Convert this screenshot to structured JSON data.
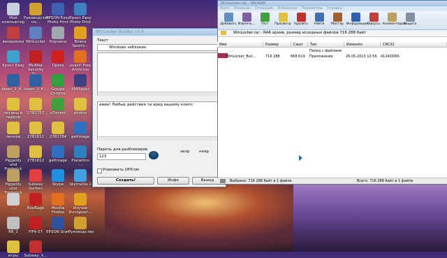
{
  "desktop": {
    "icons": [
      {
        "label": "Мой компьютер",
        "color": "#c8d0e0"
      },
      {
        "label": "Руководство по...",
        "color": "#d0a030"
      },
      {
        "label": "EPSON Easy Photo Print",
        "color": "#4060b0"
      },
      {
        "label": "Epson Easy Photo Print",
        "color": "#4080c0"
      },
      {
        "label": "венеринка",
        "color": "#c04040"
      },
      {
        "label": "WinLocker",
        "color": "#6080c0"
      },
      {
        "label": "Корзина",
        "color": "#a0a8b0"
      },
      {
        "label": "Вовка Sports...",
        "color": "#e0a020"
      },
      {
        "label": "Epson Easy",
        "color": "#40a0d0"
      },
      {
        "label": "McAfee Security Sc...",
        "color": "#c02020"
      },
      {
        "label": "Opera",
        "color": "#d02020"
      },
      {
        "label": "avast! Free Antivirus",
        "color": "#e07020"
      },
      {
        "label": "Ideen_1_К...",
        "color": "#3060a0"
      },
      {
        "label": "Ideen_2_К...",
        "color": "#3060a0"
      },
      {
        "label": "Google Chrome",
        "color": "#30a040"
      },
      {
        "label": "KMPlayer",
        "color": "#404080"
      },
      {
        "label": "логины и пароли",
        "color": "#e0c040"
      },
      {
        "label": "2781757",
        "color": "#e0c040"
      },
      {
        "label": "uTorrent",
        "color": "#40a040"
      },
      {
        "label": "photos",
        "color": "#e0c040"
      },
      {
        "label": "личное",
        "color": "#e0c040"
      },
      {
        "label": "2781811",
        "color": "#e0c040"
      },
      {
        "label": "2781784",
        "color": "#e0c040"
      },
      {
        "label": "getImage",
        "color": "#3070c0"
      },
      {
        "label": "Piggeldy und Frederick -...",
        "color": "#c0a060"
      },
      {
        "label": "2781812",
        "color": "#e0c040"
      },
      {
        "label": "getImage",
        "color": "#3070c0"
      },
      {
        "label": "Planetino -...",
        "color": "#3080c0"
      },
      {
        "label": "Piggeldy und Frederick -...",
        "color": "#c0a060"
      },
      {
        "label": "Subway Surfers",
        "color": "#e04040"
      },
      {
        "label": "Skype",
        "color": "#2090e0"
      },
      {
        "label": "Skymania 2",
        "color": "#40a0e0"
      },
      {
        "label": "...",
        "color": "#d0d0d0"
      },
      {
        "label": "BoxRage",
        "color": "#c02020"
      },
      {
        "label": "Mozilla Firefox",
        "color": "#e07020"
      },
      {
        "label": "Изучай Интернет...",
        "color": "#e0a020"
      },
      {
        "label": "RB_2",
        "color": "#c0c0c0"
      },
      {
        "label": "FIFA 07",
        "color": "#c02020"
      },
      {
        "label": "EPSON Scan",
        "color": "#3050a0"
      },
      {
        "label": "Руководство",
        "color": "#d0a030"
      },
      {
        "label": "игры",
        "color": "#e0c040"
      },
      {
        "label": "Subway_X...",
        "color": "#c03030"
      }
    ]
  },
  "dialog": {
    "title": "WinLocker Builder v0.4",
    "text_label": "Текст",
    "text_value": "Windows заблокин",
    "message_value": "ииие! Любые действия ти вред вашему компс",
    "password_label": "Пароль для разблокиров",
    "password_value": "123",
    "side_label_1": "зелр",
    "side_value_1": "ннар",
    "pack_label": "Упаковать UPX'ом",
    "create_label": "Создать!",
    "info_label": "Инфо",
    "exit_label": "Выход"
  },
  "rar": {
    "title": "WinLocker.rar - WinRAR",
    "menu": [
      "Файл",
      "Команды",
      "Операции",
      "Избранное",
      "Параметры",
      "Справка"
    ],
    "tools": [
      {
        "label": "Добавить",
        "color": "#6090c0"
      },
      {
        "label": "Извлечь...",
        "color": "#8060a0"
      },
      {
        "label": "Тест",
        "color": "#40a040"
      },
      {
        "label": "Просмотр",
        "color": "#e0c040"
      },
      {
        "label": "Удалить",
        "color": "#c03030"
      },
      {
        "label": "Найти",
        "color": "#4070b0"
      },
      {
        "label": "Мастер",
        "color": "#a06030"
      },
      {
        "label": "Информация",
        "color": "#3060b0"
      },
      {
        "label": "Вирусы",
        "color": "#c04040"
      },
      {
        "label": "Комментарий",
        "color": "#c0a060"
      },
      {
        "label": "Защита",
        "color": "#8090a0"
      }
    ],
    "path": "WinLocker.rar - RAR архив, размер исходных файлов 716 288 байт",
    "columns": [
      "Имя",
      "Размер",
      "Сжат",
      "Тип",
      "Изменён",
      "CRC32"
    ],
    "rows": [
      {
        "name": "..",
        "size": "",
        "packed": "",
        "type": "Папка с файлами",
        "modified": "",
        "crc": ""
      },
      {
        "name": "WinLocker_Buil...",
        "size": "716 288",
        "packed": "668 619",
        "type": "Приложение",
        "modified": "26.05.2013 12:56",
        "crc": "4124DD66"
      }
    ],
    "status_left": "Выбрано: 716 288 байт в 1 файле",
    "status_right": "Всего: 716 288 байт в 1 файле"
  }
}
